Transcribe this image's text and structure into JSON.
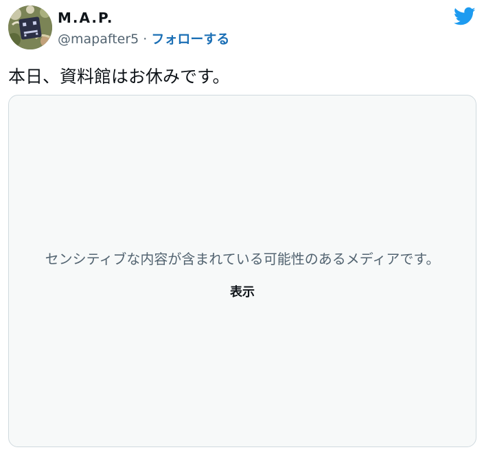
{
  "account": {
    "display_name": "M.A.P.",
    "handle": "@mapafter5",
    "separator": "·",
    "follow_label": "フォローする",
    "avatar_icon": "avatar-image",
    "platform_icon": "twitter-bird-icon"
  },
  "tweet": {
    "text": "本日、資料館はお休みです。"
  },
  "media": {
    "sensitive_warning": "センシティブな内容が含まれている可能性のあるメディアです。",
    "show_label": "表示"
  },
  "colors": {
    "brand": "#1d9bf0",
    "follow": "#1b6fb5",
    "text_primary": "#0f1419",
    "text_secondary": "#536471",
    "media_bg": "#f7f9f9",
    "border": "#cfd9de"
  }
}
